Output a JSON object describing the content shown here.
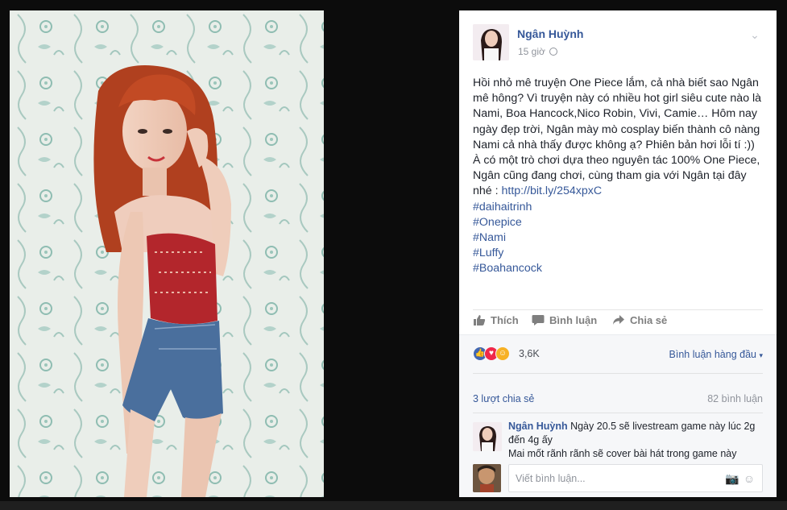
{
  "post": {
    "author": "Ngân Huỳnh",
    "time": "15 giờ",
    "privacy_icon": "globe-icon",
    "menu_icon": "chevron-down-icon",
    "paragraphs": [
      "Hồi nhỏ mê truyện One Piece lắm, cả nhà biết sao Ngân mê hông? Vì truyện này có nhiều hot girl siêu cute nào là Nami, Boa Hancock,Nico Robin, Vivi, Camie… Hôm nay ngày đẹp trời, Ngân mày mò cosplay biến thành cô nàng Nami cả nhà thấy được không ạ? Phiên bản hơi lỗi tí :))",
      "À có một trò chơi dựa theo nguyên tác 100% One Piece, Ngân cũng đang chơi, cùng tham gia với Ngân tại đây nhé : "
    ],
    "link": "http://bit.ly/254xpxC",
    "hashtags": [
      "#daihaitrinh",
      "#Onepice",
      "#Nami",
      "#Luffy",
      "#Boahancock"
    ]
  },
  "actions": {
    "like": "Thích",
    "comment": "Bình luận",
    "share": "Chia sẻ"
  },
  "stats": {
    "reactions_count": "3,6K",
    "sort_label": "Bình luận hàng đầu",
    "shares": "3 lượt chia sẻ",
    "comments": "82 bình luận"
  },
  "comment": {
    "author": "Ngân Huỳnh",
    "text_line1": " Ngày 20.5 sẽ livestream game này lúc 2g đến 4g ấy",
    "text_line2": "Mai mốt rãnh rãnh sẽ cover bài hát trong game này"
  },
  "composer": {
    "placeholder": "Viết bình luận..."
  },
  "colors": {
    "link": "#365899",
    "like_blue": "#4267b2",
    "love_red": "#f0284a",
    "haha_yellow": "#f7b125"
  }
}
